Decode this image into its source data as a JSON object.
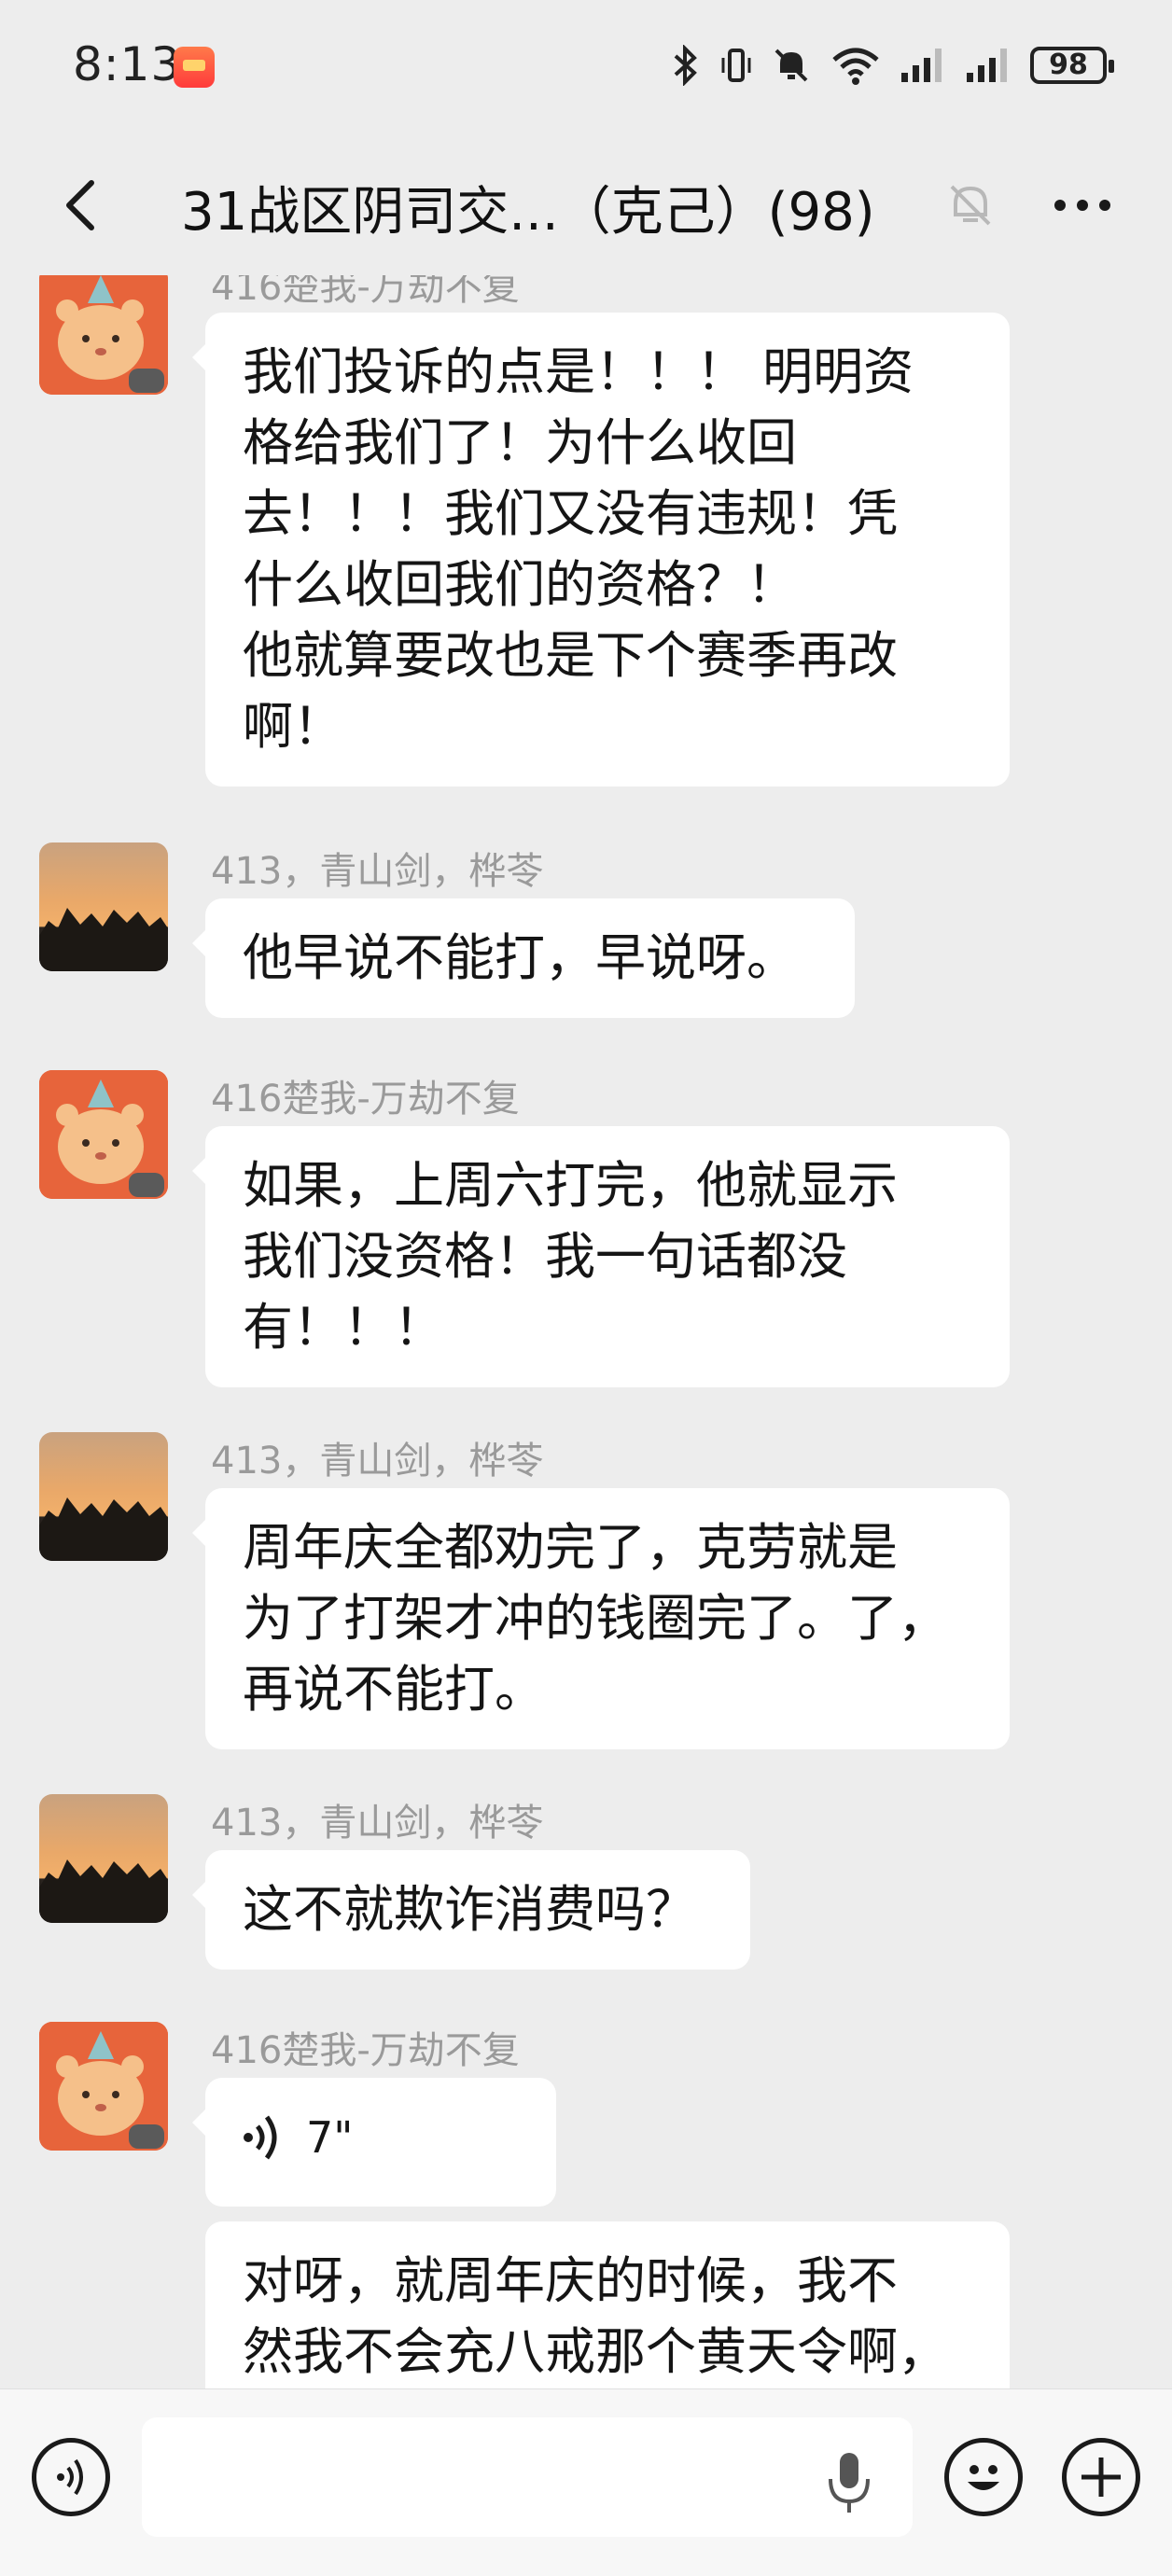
{
  "status_bar": {
    "time": "8:13",
    "battery": "98"
  },
  "header": {
    "title": "31战区阴司交...（克己）(98)"
  },
  "messages": [
    {
      "sender": "416楚我-万劫不复",
      "lines": [
        "我们投诉的点是！！！ 明明资",
        "格给我们了！为什么收回",
        "去！！！我们又没有违规！凭",
        "什么收回我们的资格？！",
        "他就算要改也是下个赛季再改",
        "啊！"
      ]
    },
    {
      "sender": "413，青山剑，桦苓",
      "lines": [
        "他早说不能打，早说呀。"
      ]
    },
    {
      "sender": "416楚我-万劫不复",
      "lines": [
        "如果，上周六打完，他就显示",
        "我们没资格！我一句话都没",
        "有！！！"
      ]
    },
    {
      "sender": "413，青山剑，桦苓",
      "lines": [
        "周年庆全都劝完了，克劳就是",
        "为了打架才冲的钱圈完了。了，",
        "再说不能打。"
      ]
    },
    {
      "sender": "413，青山剑，桦苓",
      "lines": [
        "这不就欺诈消费吗？"
      ]
    },
    {
      "sender": "416楚我-万劫不复",
      "voice_duration": "7\"",
      "lines": [
        "对呀，就周年庆的时候，我不",
        "然我不会充八戒那个黄天令啊，"
      ]
    }
  ],
  "colors": {
    "background": "#ededed",
    "bubble": "#ffffff",
    "sender_text": "#9a9a9a"
  }
}
